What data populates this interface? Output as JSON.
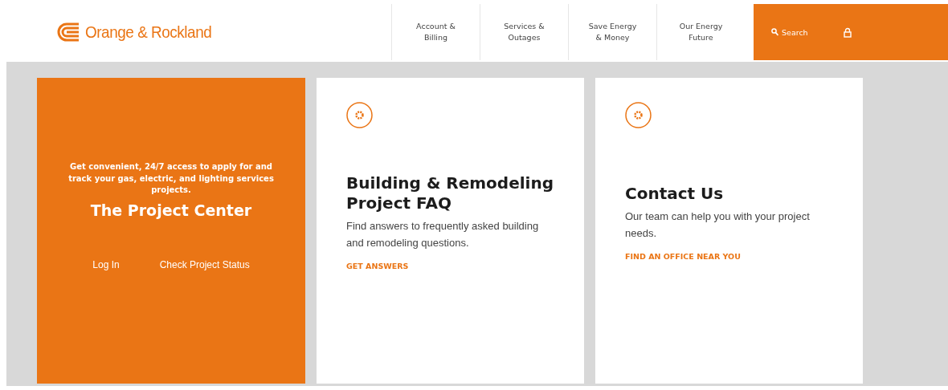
{
  "header": {
    "logo": "Orange & Rockland",
    "nav": [
      {
        "label": "Account & Billing"
      },
      {
        "label": "Services & Outages"
      },
      {
        "label": "Save Energy & Money"
      },
      {
        "label": "Our Energy Future"
      }
    ],
    "search": "Search"
  },
  "promo": {
    "text": "Get convenient, 24/7 access to apply for and track your gas, electric, and lighting services projects.",
    "title": "The Project Center",
    "links": [
      "Log In",
      "Check Project Status"
    ]
  },
  "cards": [
    {
      "title": "Building & Remodeling Project FAQ",
      "text": "Find answers to frequently asked building and remodeling questions.",
      "link": "GET ANSWERS"
    },
    {
      "title": "Contact Us",
      "text": "Our team can help you with your project needs.",
      "link": "FIND AN OFFICE NEAR YOU"
    }
  ]
}
